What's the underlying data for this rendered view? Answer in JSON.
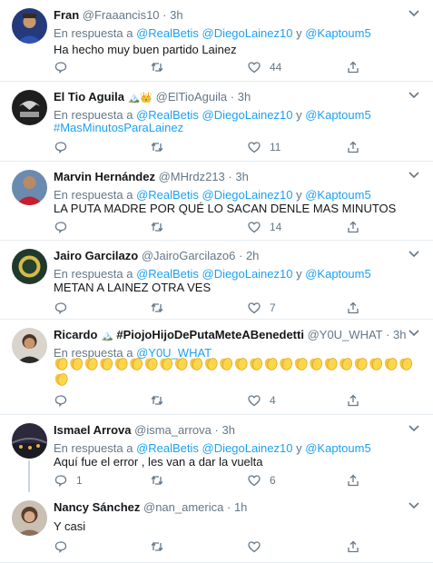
{
  "common": {
    "reply_prefix": "En respuesta a",
    "and": "y",
    "mention1": "@RealBetis",
    "mention2": "@DiegoLainez10",
    "mention3": "@Kaptoum5",
    "dot": "·"
  },
  "tweets": [
    {
      "name": "Fran",
      "handle": "@Fraaancis10",
      "time": "3h",
      "text": "Ha hecho muy buen partido Lainez",
      "reply_count": "",
      "retweet_count": "",
      "like_count": "44"
    },
    {
      "name": "El Tio Aguila",
      "emoji": "🏔️👑",
      "handle": "@ElTioAguila",
      "time": "3h",
      "hashtag": "#MasMinutosParaLainez",
      "reply_count": "",
      "retweet_count": "",
      "like_count": "11"
    },
    {
      "name": "Marvin Hernández",
      "handle": "@MHrdz213",
      "time": "3h",
      "text": "LA PUTA MADRE POR QUÉ  LO SACAN DENLE MAS MINUTOS",
      "reply_count": "",
      "retweet_count": "",
      "like_count": "14"
    },
    {
      "name": "Jairo Garcilazo",
      "handle": "@JairoGarcilazo6",
      "time": "2h",
      "text": "METAN A LAINEZ OTRA VES",
      "reply_count": "",
      "retweet_count": "",
      "like_count": "7"
    },
    {
      "name": "Ricardo",
      "emoji": "🏔️",
      "name_tag": "#PiojoHijoDePutaMeteABenedetti",
      "handle": "@Y0U_WHAT",
      "time": "3h",
      "reply_to": "@Y0U_WHAT",
      "clap_count": 25,
      "reply_count": "",
      "retweet_count": "",
      "like_count": "4"
    },
    {
      "name": "Ismael Arrova",
      "handle": "@isma_arrova",
      "time": "3h",
      "text": "Aquí fue el error , les van a dar la vuelta",
      "reply_count": "1",
      "retweet_count": "",
      "like_count": "6"
    },
    {
      "name": "Nancy Sánchez",
      "handle": "@nan_america",
      "time": "1h",
      "text": "Y casi",
      "reply_count": "",
      "retweet_count": "",
      "like_count": ""
    }
  ],
  "colors": {
    "link": "#1da1f2",
    "muted": "#657786",
    "divider": "#e6ecf0"
  },
  "icons": [
    "reply-icon",
    "retweet-icon",
    "like-icon",
    "share-icon",
    "chevron-down-icon",
    "clapping-hands-emoji"
  ]
}
